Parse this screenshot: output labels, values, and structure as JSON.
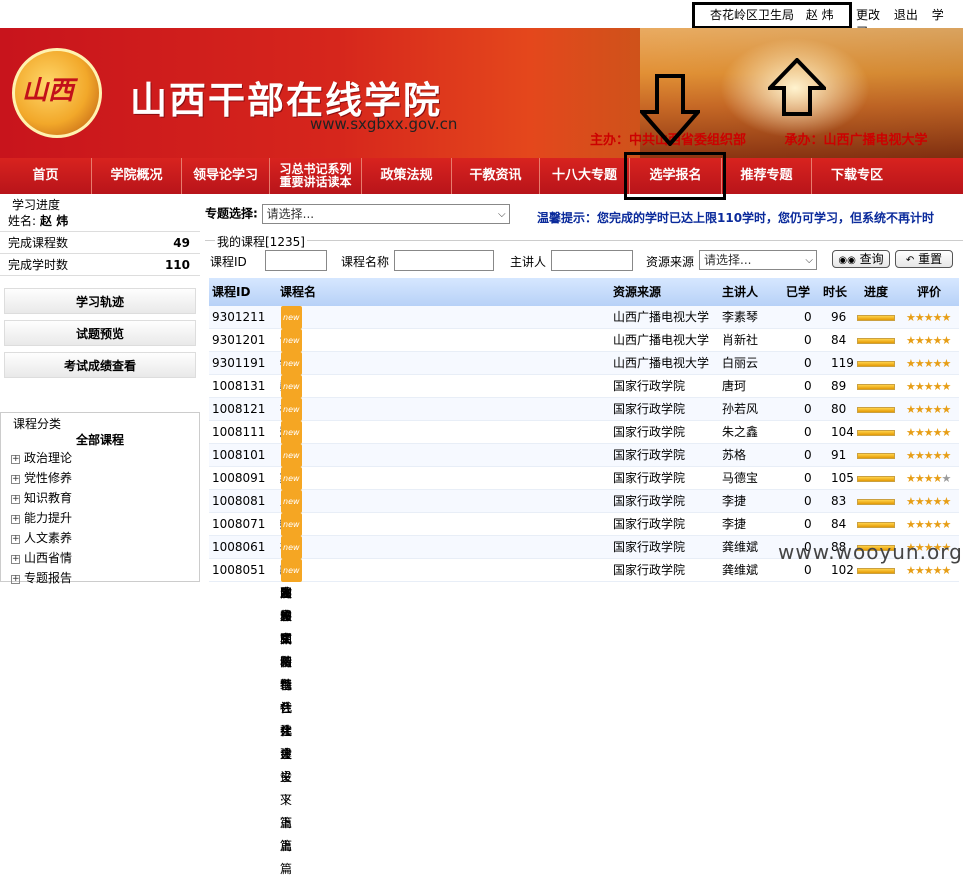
{
  "topbar": {
    "org": "杏花岭区卫生局",
    "user": "赵 炜",
    "links": [
      "更改",
      "退出",
      "学习"
    ]
  },
  "banner": {
    "logo_text": "山西",
    "logo_sub": "干部在线",
    "title": "山西干部在线学院",
    "url": "www.sxgbxx.gov.cn",
    "host": "主办：中共山西省委组织部",
    "organizer": "承办：山西广播电视大学"
  },
  "nav": {
    "items": [
      "首页",
      "学院概况",
      "领导论学习",
      "习总书记系列",
      "重要讲话读本",
      "政策法规",
      "干教资讯",
      "十八大专题",
      "选学报名",
      "推荐专题",
      "下载专区"
    ]
  },
  "sidebar": {
    "progress_title": "学习进度",
    "name_label": "姓名:",
    "name_value": "赵 炜",
    "completed_courses_label": "完成课程数",
    "completed_courses_value": "49",
    "completed_hours_label": "完成学时数",
    "completed_hours_value": "110",
    "buttons": [
      "学习轨迹",
      "试题预览",
      "考试成绩查看"
    ],
    "category_title": "课程分类",
    "category_all": "全部课程",
    "categories": [
      "政治理论",
      "党性修养",
      "知识教育",
      "能力提升",
      "人文素养",
      "山西省情",
      "专题报告"
    ]
  },
  "filters": {
    "topic_label": "专题选择:",
    "topic_placeholder": "请选择...",
    "notice": "温馨提示：您完成的学时已达上限110学时，您仍可学习，但系统不再计时",
    "my_courses": "我的课程[1235]",
    "course_id_label": "课程ID",
    "course_name_label": "课程名称",
    "speaker_label": "主讲人",
    "source_label": "资源来源",
    "source_placeholder": "请选择...",
    "search_button": "查询",
    "reset_button": "重置"
  },
  "table": {
    "columns": [
      "课程ID",
      "课程名",
      "资源来源",
      "主讲人",
      "已学",
      "时长",
      "进度",
      "评价"
    ],
    "rows": [
      {
        "id": "9301211",
        "name": "以诚为信 提升政府公信力",
        "source": "山西广播电视大学",
        "speaker": "李素琴",
        "learned": "0",
        "duration": "96",
        "stars": 5
      },
      {
        "id": "9301201",
        "name": "习近平总书记的哲学思想",
        "source": "山西广播电视大学",
        "speaker": "肖新社",
        "learned": "0",
        "duration": "84",
        "stars": 5
      },
      {
        "id": "9301191",
        "name": "物权法理论与实务",
        "source": "山西广播电视大学",
        "speaker": "白丽云",
        "learned": "0",
        "duration": "119",
        "stars": 5
      },
      {
        "id": "1008131",
        "name": "建设美丽中国",
        "source": "国家行政学院",
        "speaker": "唐珂",
        "learned": "0",
        "duration": "89",
        "stars": 5
      },
      {
        "id": "1008121",
        "name": "社会主义文化强国建设",
        "source": "国家行政学院",
        "speaker": "孙若风",
        "learned": "0",
        "duration": "80",
        "stars": 5
      },
      {
        "id": "1008111",
        "name": "加快转变经济发展方式",
        "source": "国家行政学院",
        "speaker": "朱之鑫",
        "learned": "0",
        "duration": "104",
        "stars": 5
      },
      {
        "id": "1008101",
        "name": "国际形势与中国外交",
        "source": "国家行政学院",
        "speaker": "苏格",
        "learned": "0",
        "duration": "91",
        "stars": 5
      },
      {
        "id": "1008091",
        "name": "加快推进国防和军队现代化",
        "source": "国家行政学院",
        "speaker": "马德宝",
        "learned": "0",
        "duration": "105",
        "stars": 4
      },
      {
        "id": "1008081",
        "name": "坚持和发展中国特色社会主义·下篇",
        "source": "国家行政学院",
        "speaker": "李捷",
        "learned": "0",
        "duration": "83",
        "stars": 5
      },
      {
        "id": "1008071",
        "name": "坚持和发展中国特色社会主义·上篇",
        "source": "国家行政学院",
        "speaker": "李捷",
        "learned": "0",
        "duration": "84",
        "stars": 5
      },
      {
        "id": "1008061",
        "name": "社会主义和谐社会建设·下篇",
        "source": "国家行政学院",
        "speaker": "龚维斌",
        "learned": "0",
        "duration": "88",
        "stars": 5
      },
      {
        "id": "1008051",
        "name": "社会主义和谐社会建设·上篇",
        "source": "国家行政学院",
        "speaker": "龚维斌",
        "learned": "0",
        "duration": "102",
        "stars": 5
      }
    ],
    "new_badge": "new"
  },
  "watermark": "www.wooyun.org"
}
